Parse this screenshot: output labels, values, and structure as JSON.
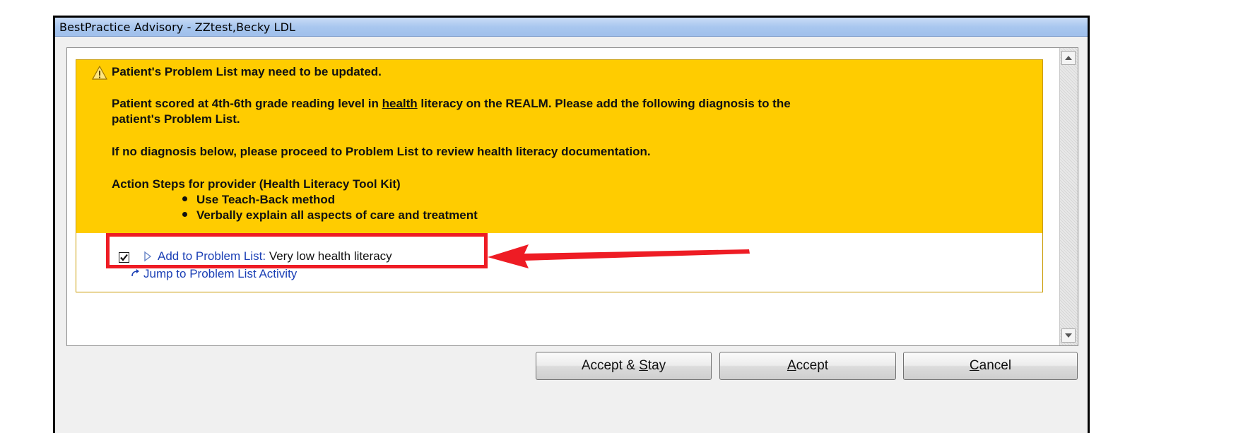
{
  "window": {
    "title": "BestPractice Advisory - ZZtest,Becky LDL"
  },
  "advisory": {
    "heading": "Patient's Problem List may need to be updated.",
    "para1_before": "Patient scored at 4th-6th grade reading level in ",
    "para1_underlined": "health",
    "para1_after": " literacy on the REALM. Please add the following diagnosis to the",
    "para1_line2": "patient's Problem List.",
    "para2": "If no diagnosis below, please proceed to Problem List to review health literacy documentation.",
    "action_steps_title": "Action Steps for provider (Health Literacy Tool Kit)",
    "steps": [
      "Use Teach-Back method",
      "Verbally explain all aspects of care and treatment"
    ],
    "order": {
      "checked": true,
      "label": "Add to Problem List:",
      "value": "Very low health literacy"
    },
    "jump_link": "Jump to Problem List Activity"
  },
  "buttons": {
    "accept_stay_prefix": "Accept & ",
    "accept_stay_mnemonic": "S",
    "accept_stay_suffix": "tay",
    "accept_mnemonic": "A",
    "accept_suffix": "ccept",
    "cancel_mnemonic": "C",
    "cancel_suffix": "ancel"
  },
  "colors": {
    "advisory_bg": "#ffcc00",
    "link": "#1a3fb5",
    "highlight": "#ee1c24",
    "titlebar": "#a9c7ef"
  },
  "icons": [
    "warning-icon",
    "checkbox-checked-icon",
    "expand-triangle-icon",
    "jump-arrow-icon",
    "scroll-up-icon",
    "scroll-down-icon"
  ]
}
